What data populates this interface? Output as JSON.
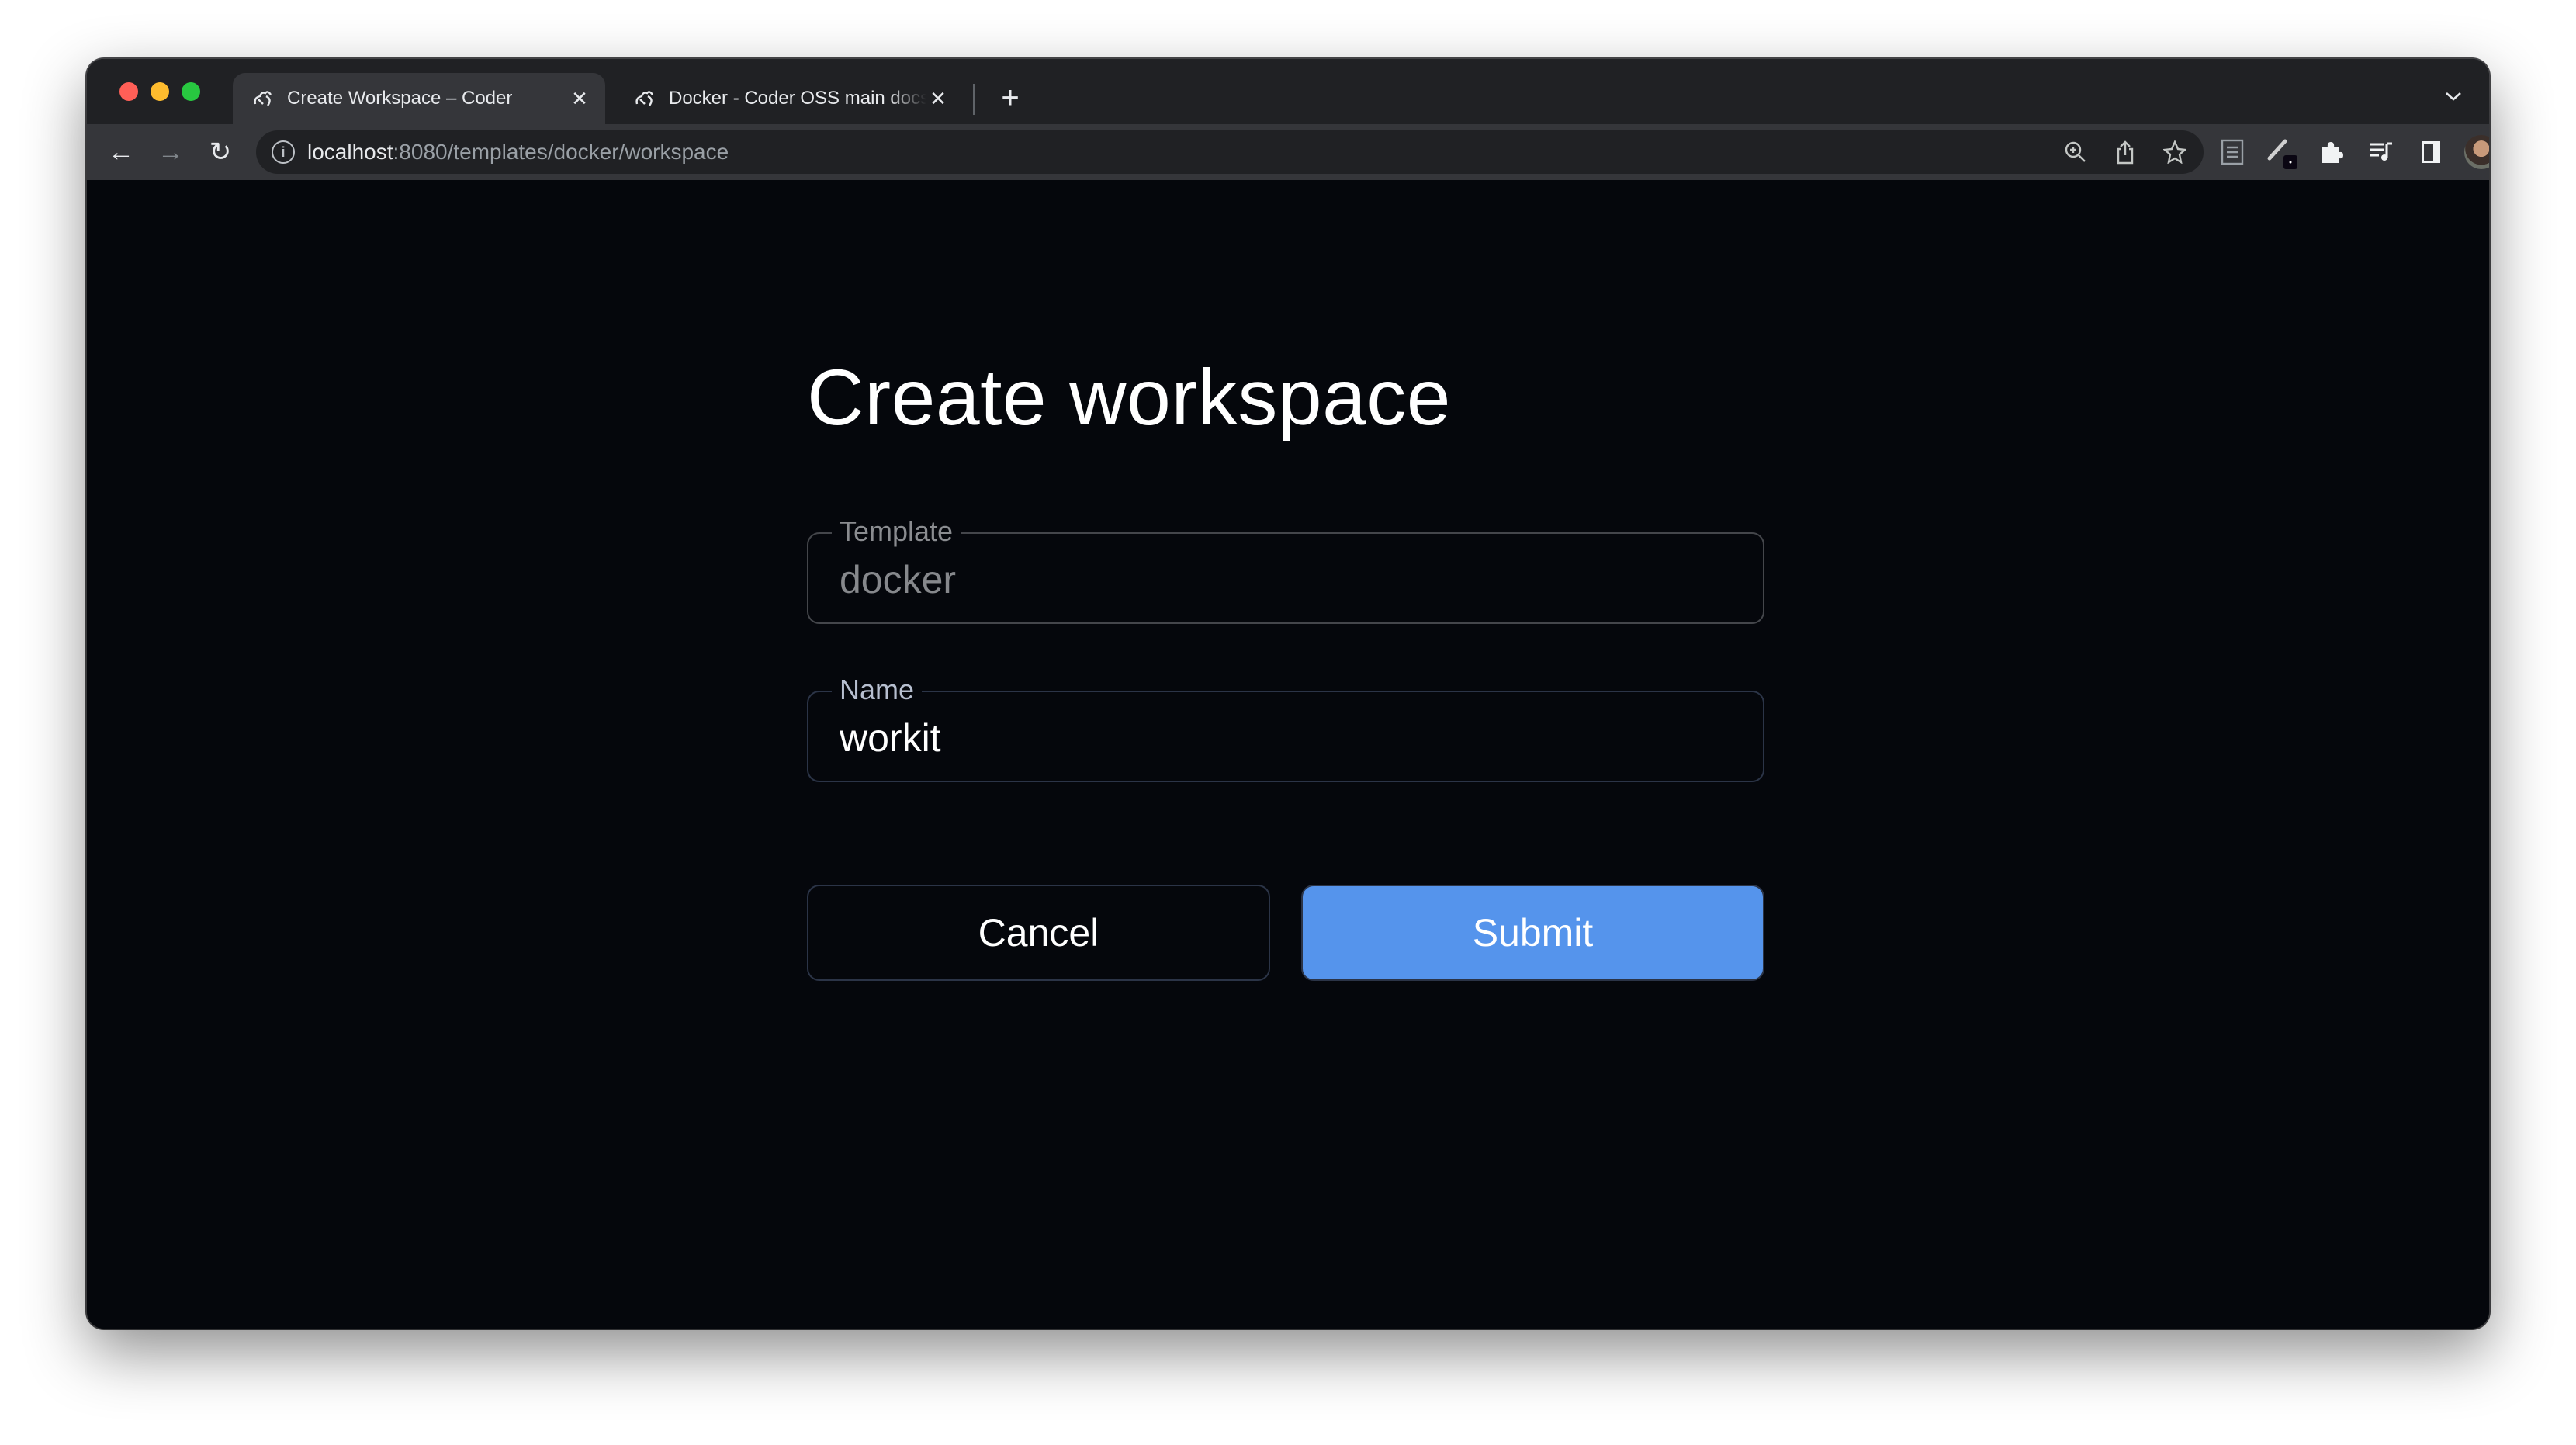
{
  "browser": {
    "tabs": [
      {
        "title": "Create Workspace – Coder",
        "active": true,
        "favicon": "coder-logo-icon"
      },
      {
        "title": "Docker - Coder OSS main docs",
        "active": false,
        "favicon": "coder-logo-icon"
      }
    ],
    "new_tab_symbol": "+",
    "close_symbol": "✕",
    "tab_menu_symbol": "⌄",
    "nav": {
      "back": "←",
      "forward": "→",
      "reload": "↻"
    },
    "url": {
      "host": "localhost",
      "path": ":8080/templates/docker/workspace"
    },
    "omnibox_icons": [
      "zoom-icon",
      "share-icon",
      "bookmark-star-icon"
    ],
    "extension_icons": [
      "reader-mode-icon",
      "pen-extension-icon",
      "extensions-puzzle-icon",
      "media-queue-icon",
      "side-panel-icon",
      "profile-avatar",
      "more-menu-icon"
    ],
    "colors": {
      "traffic_red": "#ff5f57",
      "traffic_yellow": "#febc2e",
      "traffic_green": "#28c840"
    }
  },
  "page": {
    "title": "Create workspace",
    "form": {
      "template": {
        "label": "Template",
        "value": "docker",
        "disabled": true
      },
      "name": {
        "label": "Name",
        "value": "workit"
      }
    },
    "buttons": {
      "cancel": "Cancel",
      "submit": "Submit"
    },
    "colors": {
      "background": "#05070c",
      "primary": "#5594ec"
    }
  }
}
